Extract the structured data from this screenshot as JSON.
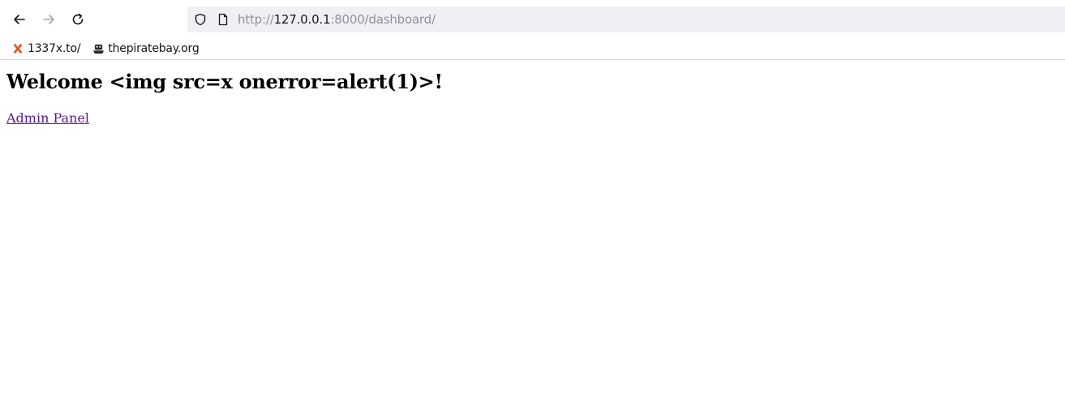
{
  "browser": {
    "url": {
      "scheme": "http://",
      "host": "127.0.0.1",
      "rest": ":8000/dashboard/"
    },
    "icons": {
      "back": "back-arrow-icon",
      "forward": "forward-arrow-icon",
      "reload": "reload-icon",
      "shield": "tracking-protection-shield-icon",
      "page": "page-info-icon"
    }
  },
  "bookmarks": [
    {
      "label": "1337x.to/",
      "icon": "1337x-favicon-icon",
      "color": "#e05a24"
    },
    {
      "label": "thepiratebay.org",
      "icon": "pirate-ship-favicon-icon",
      "color": "#2b2b2b"
    }
  ],
  "page": {
    "heading": "Welcome <img src=x onerror=alert(1)>!",
    "link_label": "Admin Panel"
  },
  "colors": {
    "urlbar_bg": "#f0f0f4",
    "link_visited": "#551a8b"
  }
}
